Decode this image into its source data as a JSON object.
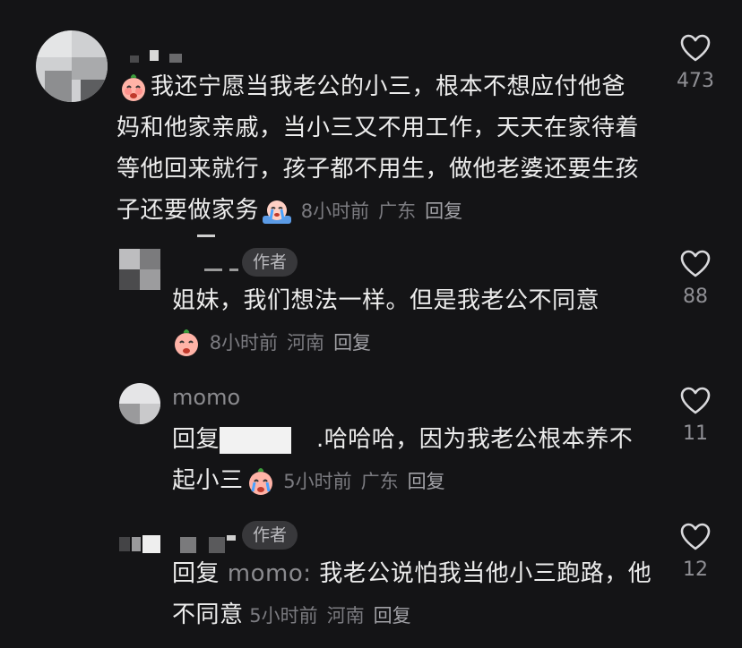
{
  "comments": [
    {
      "text": "我还宁愿当我老公的小三，根本不想应付他爸妈和他家亲戚，当小三又不用工作，天天在家待着等他回来就行，孩子都不用生，做他老婆还要生孩子还要做家务",
      "time": "8小时前",
      "location": "广东",
      "reply": "回复",
      "likes": "473"
    },
    {
      "badge": "作者",
      "text": "姐妹，我们想法一样。但是我老公不同意",
      "time": "8小时前",
      "location": "河南",
      "reply": "回复",
      "likes": "88"
    },
    {
      "username": "momo",
      "reply_prefix": "回复",
      "text": ".哈哈哈，因为我老公根本养不起小三",
      "time": "5小时前",
      "location": "广东",
      "reply": "回复",
      "likes": "11"
    },
    {
      "badge": "作者",
      "reply_prefix": "回复",
      "mention": "momo:",
      "text": "我老公说怕我当他小三跑路，他不同意",
      "time": "5小时前",
      "location": "河南",
      "reply": "回复",
      "likes": "12"
    }
  ],
  "icons": {
    "like": "heart-outline-icon",
    "emoji": "crying-face-emoji"
  },
  "colors": {
    "background": "#141416",
    "text": "#ececec",
    "meta": "#7b7b80"
  }
}
